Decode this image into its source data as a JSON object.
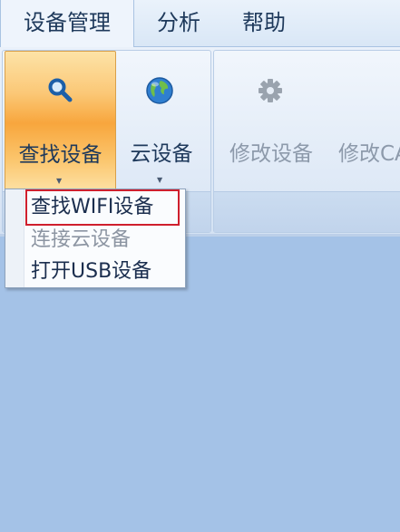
{
  "menu": {
    "tabs": [
      {
        "label": "设备管理",
        "active": true
      },
      {
        "label": "分析",
        "active": false
      },
      {
        "label": "帮助",
        "active": false
      }
    ]
  },
  "ribbon": {
    "buttons": [
      {
        "label": "查找设备",
        "icon": "search-icon",
        "active": true,
        "has_dropdown": true
      },
      {
        "label": "云设备",
        "icon": "globe-icon",
        "active": false,
        "has_dropdown": true
      },
      {
        "label": "修改设备",
        "icon": "gear-icon",
        "disabled": true
      },
      {
        "label": "修改CA",
        "disabled": true
      }
    ]
  },
  "dropdown": {
    "items": [
      {
        "label": "查找WIFI设备",
        "highlighted": true
      },
      {
        "label": "连接云设备",
        "disabled": true
      },
      {
        "label": "打开USB设备",
        "disabled": false
      }
    ]
  },
  "colors": {
    "background": "#a4c2e7",
    "active_button": "#f8a63d",
    "highlight_border": "#cf1f2d",
    "text": "#1e395b",
    "disabled_text": "#8d9aab"
  }
}
